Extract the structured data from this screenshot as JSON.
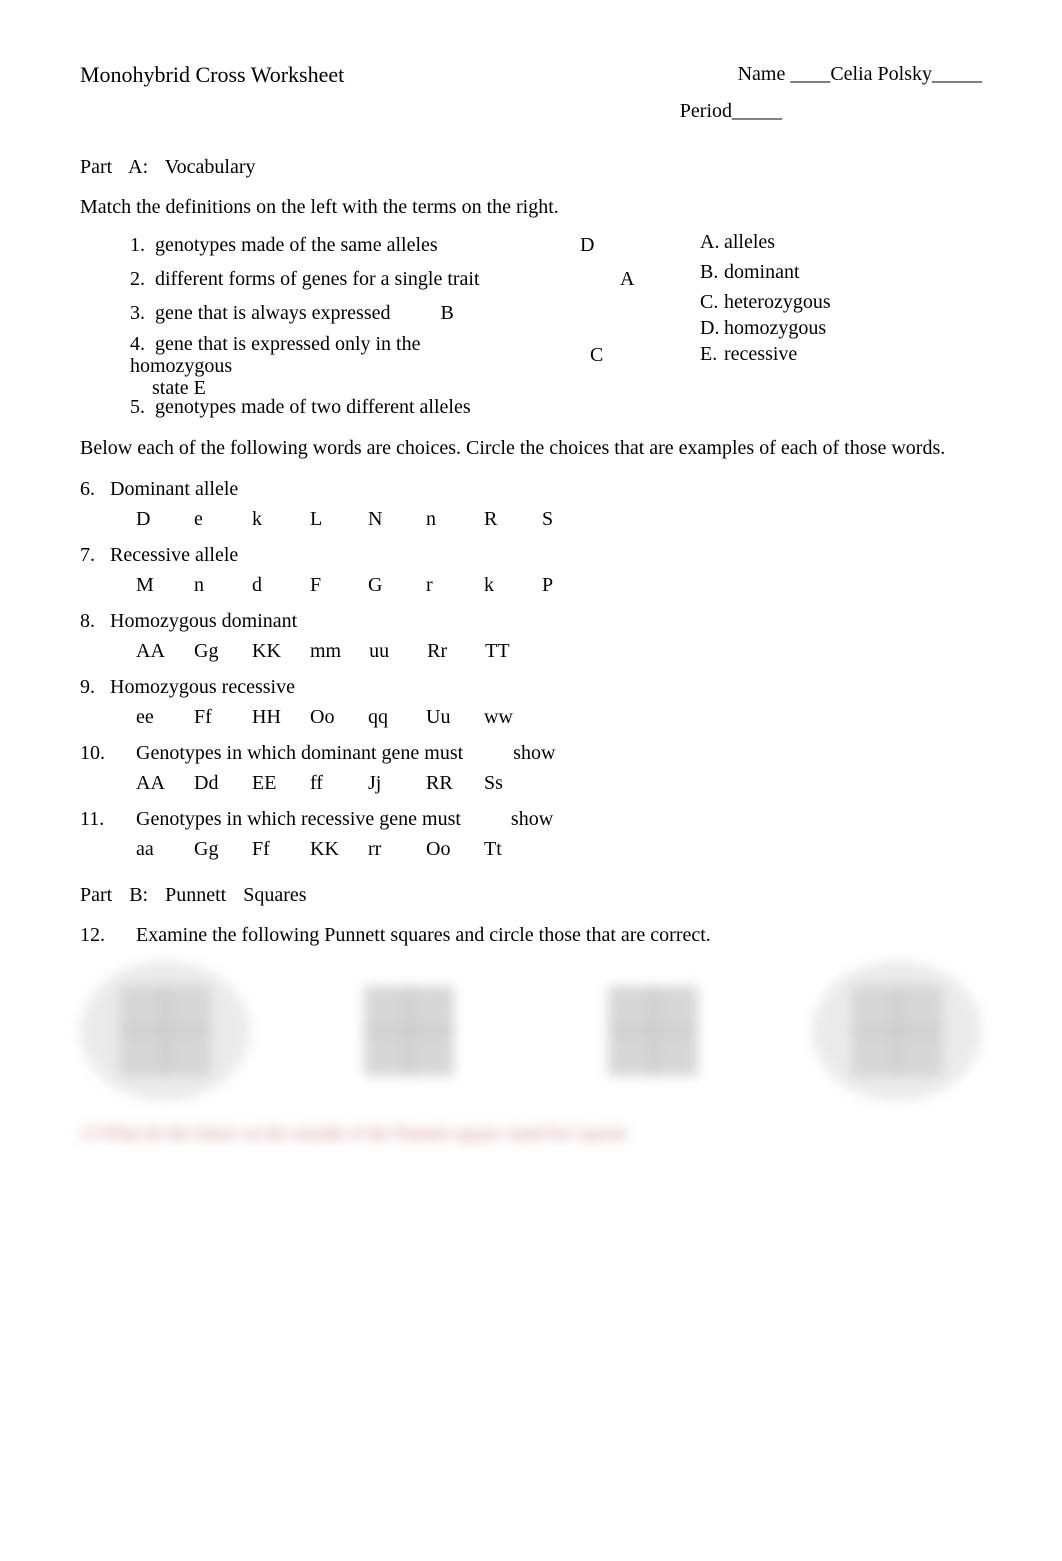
{
  "header": {
    "title": "Monohybrid Cross Worksheet",
    "name_label": "Name ____",
    "student_name": "Celia Polsky",
    "name_trail": "_____",
    "period_label": "Period_____"
  },
  "partA": {
    "heading_part": "Part",
    "heading_letter": "A:",
    "heading_text": "Vocabulary",
    "instructions": "Match the definitions on the left with the terms on the right.",
    "defs": [
      {
        "num": "1.",
        "text": "genotypes made of the same alleles",
        "answer": "D"
      },
      {
        "num": "2.",
        "text": "different forms of genes for a single trait",
        "answer": "A"
      },
      {
        "num": "3.",
        "text": "gene that is always expressed",
        "answer": "B"
      },
      {
        "num": "4.",
        "text": "gene that is expressed only in the homozygous",
        "sub": "state   E",
        "answer": ""
      },
      {
        "num": "5.",
        "text": "genotypes made of two different alleles",
        "answer": "C"
      }
    ],
    "terms": [
      {
        "letter": "A.",
        "text": "alleles"
      },
      {
        "letter": "B.",
        "text": "dominant"
      },
      {
        "letter": "C.",
        "text": "heterozygous"
      },
      {
        "letter": "D.",
        "text": "homozygous"
      },
      {
        "letter": "E.",
        "text": "recessive"
      }
    ],
    "below_text": "Below each of the following words are choices. Circle the choices that are examples of each of          those words.",
    "q6": {
      "num": "6.",
      "title": "Dominant allele",
      "choices": [
        "D",
        "e",
        "k",
        "L",
        "N",
        "n",
        "R",
        "S"
      ]
    },
    "q7": {
      "num": "7.",
      "title": "Recessive allele",
      "choices": [
        "M",
        "n",
        "d",
        "F",
        "G",
        "r",
        "k",
        "P"
      ]
    },
    "q8": {
      "num": "8.",
      "title": "Homozygous dominant",
      "choices": [
        "AA",
        "Gg",
        "KK",
        "mm",
        "uu",
        "Rr",
        "TT"
      ]
    },
    "q9": {
      "num": "9.",
      "title": "Homozygous recessive",
      "choices": [
        "ee",
        "Ff",
        "HH",
        "Oo",
        "qq",
        "Uu",
        "ww"
      ]
    },
    "q10": {
      "num": "10.",
      "title": "Genotypes in which dominant gene must",
      "trail": "show",
      "choices": [
        "AA",
        "Dd",
        "EE",
        "ff",
        "Jj",
        "RR",
        "Ss"
      ]
    },
    "q11": {
      "num": "11.",
      "title": "Genotypes in which recessive gene must",
      "trail": "show",
      "choices": [
        "aa",
        "Gg",
        "Ff",
        "KK",
        "rr",
        "Oo",
        "Tt"
      ]
    }
  },
  "partB": {
    "heading_part": "Part",
    "heading_letter": "B:",
    "heading_text1": "Punnett",
    "heading_text2": "Squares",
    "q12": {
      "num": "12.",
      "text": "Examine the following Punnett squares and circle those that are correct."
    }
  },
  "blur_footer": "13 What do the letters on the outside of the Punnett square stand for?                                                  parent"
}
